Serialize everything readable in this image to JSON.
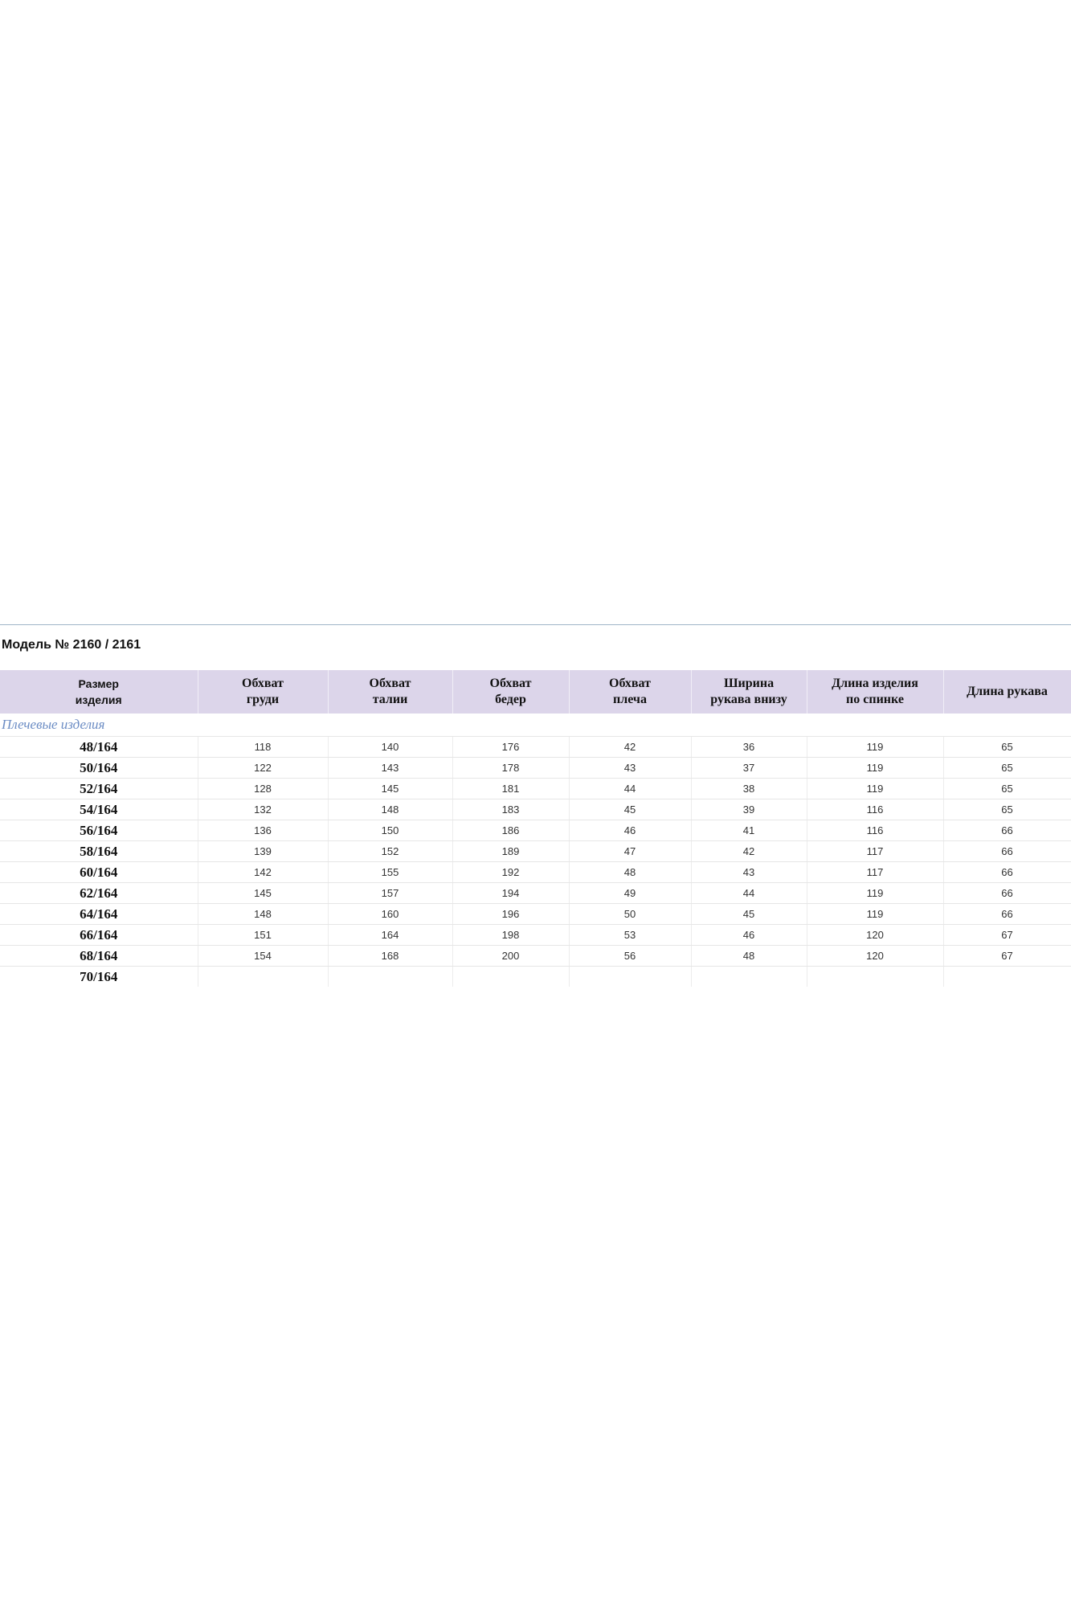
{
  "model_title": "Модель № 2160 / 2161",
  "headers": [
    [
      "Размер",
      "изделия"
    ],
    [
      "Обхват",
      "груди"
    ],
    [
      "Обхват",
      "талии"
    ],
    [
      "Обхват",
      "бедер"
    ],
    [
      "Обхват",
      "плеча"
    ],
    [
      "Ширина",
      "рукава внизу"
    ],
    [
      "Длина изделия",
      "по спинке"
    ],
    [
      "Длина рукава"
    ]
  ],
  "section_label": "Плечевые изделия",
  "rows": [
    [
      "48/164",
      "118",
      "140",
      "176",
      "42",
      "36",
      "119",
      "65"
    ],
    [
      "50/164",
      "122",
      "143",
      "178",
      "43",
      "37",
      "119",
      "65"
    ],
    [
      "52/164",
      "128",
      "145",
      "181",
      "44",
      "38",
      "119",
      "65"
    ],
    [
      "54/164",
      "132",
      "148",
      "183",
      "45",
      "39",
      "116",
      "65"
    ],
    [
      "56/164",
      "136",
      "150",
      "186",
      "46",
      "41",
      "116",
      "66"
    ],
    [
      "58/164",
      "139",
      "152",
      "189",
      "47",
      "42",
      "117",
      "66"
    ],
    [
      "60/164",
      "142",
      "155",
      "192",
      "48",
      "43",
      "117",
      "66"
    ],
    [
      "62/164",
      "145",
      "157",
      "194",
      "49",
      "44",
      "119",
      "66"
    ],
    [
      "64/164",
      "148",
      "160",
      "196",
      "50",
      "45",
      "119",
      "66"
    ],
    [
      "66/164",
      "151",
      "164",
      "198",
      "53",
      "46",
      "120",
      "67"
    ],
    [
      "68/164",
      "154",
      "168",
      "200",
      "56",
      "48",
      "120",
      "67"
    ],
    [
      "70/164",
      "",
      "",
      "",
      "",
      "",
      "",
      ""
    ]
  ]
}
